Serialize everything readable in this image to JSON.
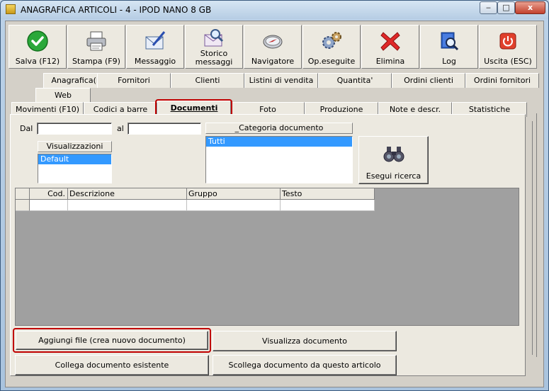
{
  "window": {
    "title": "ANAGRAFICA ARTICOLI - 4 - IPOD NANO 8 GB",
    "minimize": "‒",
    "maximize": "□",
    "close": "x"
  },
  "toolbar": {
    "save": "Salva (F12)",
    "print": "Stampa (F9)",
    "message": "Messaggio",
    "history_line1": "Storico",
    "history_line2": "messaggi",
    "navigator": "Navigatore",
    "operations": "Op.eseguite",
    "delete": "Elimina",
    "log": "Log",
    "exit": "Uscita (ESC)"
  },
  "tabs_row1": [
    "Anagrafica(F5)",
    "Fornitori",
    "Clienti",
    "Listini di vendita",
    "Quantita'",
    "Ordini clienti",
    "Ordini fornitori"
  ],
  "tabs_row2": [
    "Web"
  ],
  "tabs_row3": [
    "Movimenti (F10)",
    "Codici a barre",
    "Documenti",
    "Foto",
    "Produzione",
    "Note e descr.",
    "Statistiche"
  ],
  "filters": {
    "from_label": "Dal",
    "to_label": "al",
    "from_value": "",
    "to_value": ""
  },
  "views": {
    "header": "Visualizzazioni",
    "selected": "Default"
  },
  "category": {
    "header": "_Categoria documento",
    "selected": "Tutti"
  },
  "search_button": "Esegui ricerca",
  "grid": {
    "columns": [
      "Cod.",
      "Descrizione",
      "Gruppo",
      "Testo"
    ]
  },
  "actions": {
    "add_file": "Aggiungi file (crea nuovo documento)",
    "view_document": "Visualizza documento",
    "link_existing": "Collega documento esistente",
    "unlink": "Scollega documento da questo articolo"
  }
}
